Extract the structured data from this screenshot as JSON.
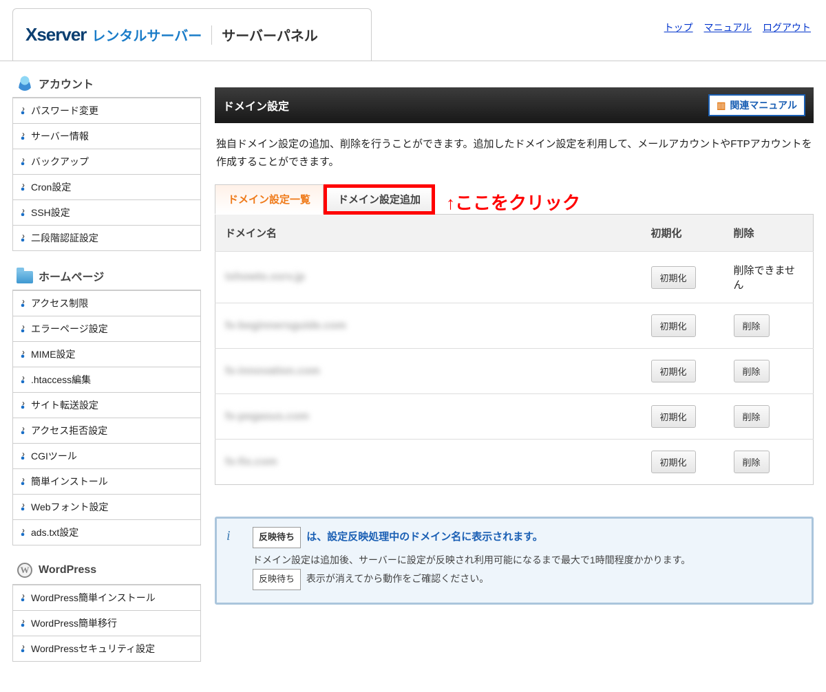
{
  "top_links": {
    "top": "トップ",
    "manual": "マニュアル",
    "logout": "ログアウト"
  },
  "header": {
    "brand": "Xserver",
    "rental": "レンタルサーバー",
    "panel_title": "サーバーパネル"
  },
  "sidebar": {
    "account": {
      "title": "アカウント",
      "items": [
        "パスワード変更",
        "サーバー情報",
        "バックアップ",
        "Cron設定",
        "SSH設定",
        "二段階認証設定"
      ]
    },
    "homepage": {
      "title": "ホームページ",
      "items": [
        "アクセス制限",
        "エラーページ設定",
        "MIME設定",
        ".htaccess編集",
        "サイト転送設定",
        "アクセス拒否設定",
        "CGIツール",
        "簡単インストール",
        "Webフォント設定",
        "ads.txt設定"
      ]
    },
    "wordpress": {
      "title": "WordPress",
      "icon_letter": "W",
      "items": [
        "WordPress簡単インストール",
        "WordPress簡単移行",
        "WordPressセキュリティ設定"
      ]
    }
  },
  "main": {
    "title": "ドメイン設定",
    "related_manual": "関連マニュアル",
    "desc": "独自ドメイン設定の追加、削除を行うことができます。追加したドメイン設定を利用して、メールアカウントやFTPアカウントを作成することができます。",
    "tabs": {
      "list": "ドメイン設定一覧",
      "add": "ドメイン設定追加"
    },
    "annotation": "↑ここをクリック",
    "table": {
      "head": {
        "domain": "ドメイン名",
        "init": "初期化",
        "del": "削除"
      },
      "init_btn": "初期化",
      "del_btn": "削除",
      "cannot_delete": "削除できません",
      "rows": [
        {
          "domain_masked": "txhowto.xsrv.jp",
          "deletable": false
        },
        {
          "domain_masked": "fx-beginnersguide.com",
          "deletable": true
        },
        {
          "domain_masked": "fx-innovation.com",
          "deletable": true
        },
        {
          "domain_masked": "fx-pegasus.com",
          "deletable": true
        },
        {
          "domain_masked": "fx-fix.com",
          "deletable": true
        }
      ]
    },
    "info": {
      "badge": "反映待ち",
      "title_rest": "は、設定反映処理中のドメイン名に表示されます。",
      "line1": "ドメイン設定は追加後、サーバーに設定が反映され利用可能になるまで最大で1時間程度かかります。",
      "line2": "表示が消えてから動作をご確認ください。"
    }
  }
}
